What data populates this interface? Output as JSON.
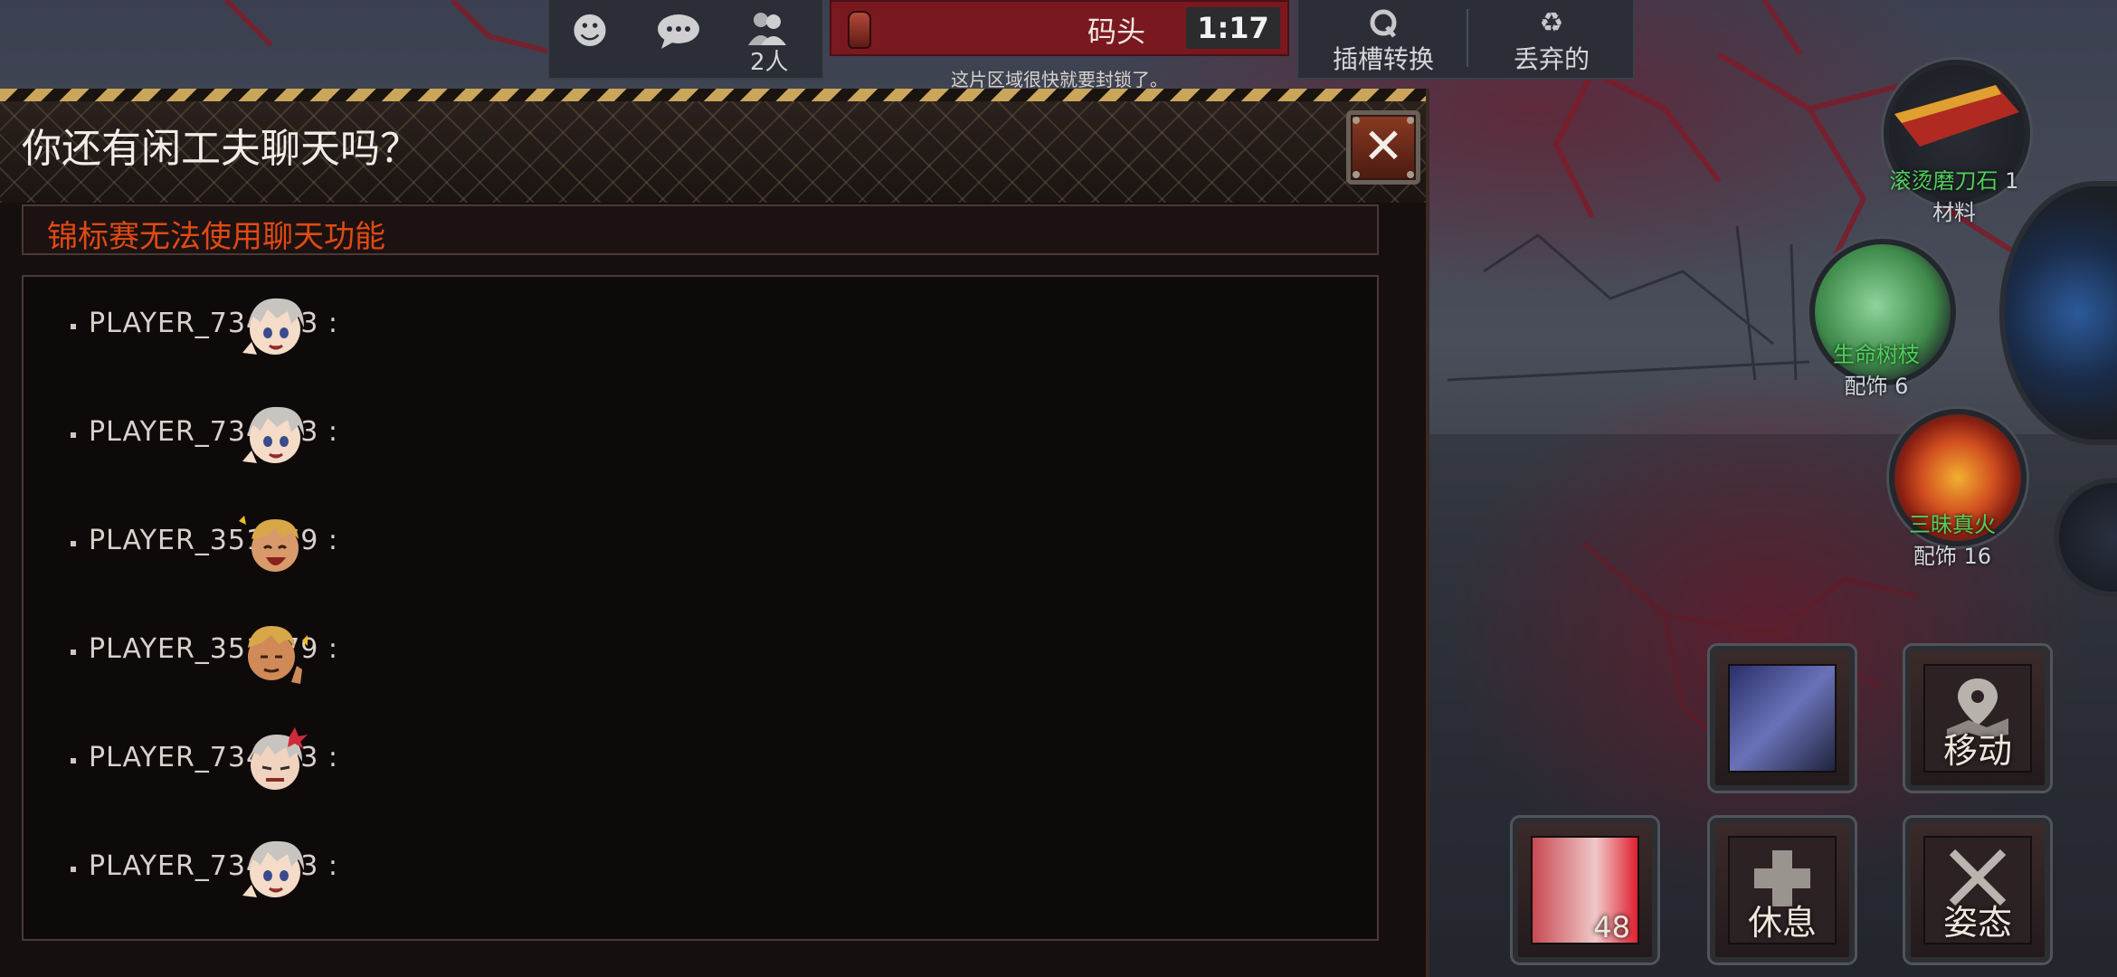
{
  "top_bar": {
    "social_icons": [
      "emoji-icon",
      "chat-bubble-icon",
      "people-icon"
    ],
    "people_count": "2人",
    "location": {
      "name": "码头",
      "timer": "1:17",
      "icon": "lantern-icon"
    },
    "area_warning": "这片区域很快就要封锁了。",
    "actions": [
      {
        "label": "插槽转换",
        "icon": "slot-swap-icon"
      },
      {
        "label": "丢弃的",
        "icon": "recycle-icon"
      }
    ]
  },
  "chat_panel": {
    "title": "你还有闲工夫聊天吗？",
    "notice": "锦标赛无法使用聊天功能",
    "messages": [
      {
        "player": "PLAYER_734293 :",
        "emote": "silver-hair-smile-emote"
      },
      {
        "player": "PLAYER_734293 :",
        "emote": "silver-hair-smile-emote"
      },
      {
        "player": "PLAYER_351579 :",
        "emote": "blond-laugh-emote"
      },
      {
        "player": "PLAYER_351579 :",
        "emote": "blond-thumbsup-emote"
      },
      {
        "player": "PLAYER_734293 :",
        "emote": "silver-hair-angry-emote"
      },
      {
        "player": "PLAYER_734293 :",
        "emote": "silver-hair-smile-emote"
      }
    ]
  },
  "right_items": [
    {
      "name": "滚烫磨刀石",
      "count": "1",
      "category": "材料"
    },
    {
      "name": "生命树枝",
      "count": "",
      "category": "配饰 6"
    },
    {
      "name": "三昧真火",
      "count": "",
      "category": "配饰 16"
    }
  ],
  "action_buttons": {
    "skill_card": {
      "label": ""
    },
    "move": {
      "label": "移动"
    },
    "consumable": {
      "count": "48"
    },
    "rest": {
      "label": "休息"
    },
    "stance": {
      "label": "姿态"
    }
  },
  "colors": {
    "notice": "#e04a12",
    "location_bar": "#7a1820",
    "item_name": "#4fcf5a"
  }
}
